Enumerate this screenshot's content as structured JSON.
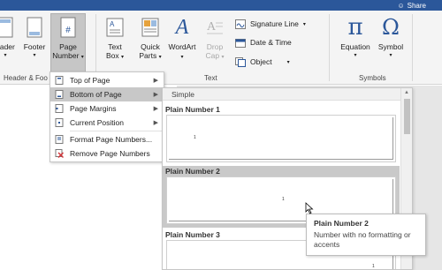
{
  "titlebar": {
    "share_label": "Share",
    "share_icon": "person-icon"
  },
  "ribbon": {
    "header_label": "eader",
    "footer_label": "Footer",
    "page_number_line1": "Page",
    "page_number_line2": "Number",
    "page_number_glyph": "#",
    "text_box_line1": "Text",
    "text_box_line2": "Box",
    "quick_parts_line1": "Quick",
    "quick_parts_line2": "Parts",
    "wordart_label": "WordArt",
    "wordart_glyph": "A",
    "drop_cap_line1": "Drop",
    "drop_cap_line2": "Cap",
    "drop_cap_glyph": "A",
    "signature_line_label": "Signature Line",
    "date_time_label": "Date & Time",
    "object_label": "Object",
    "equation_label": "Equation",
    "equation_glyph": "π",
    "symbol_label": "Symbol",
    "symbol_glyph": "Ω",
    "group_header_footer": "Header & Foo",
    "group_text": "Text",
    "group_symbols": "Symbols",
    "accent_color": "#2b579a",
    "active_bg": "#c6c6c6"
  },
  "menu": {
    "items": [
      {
        "label": "Top of Page",
        "has_submenu": true
      },
      {
        "label": "Bottom of Page",
        "has_submenu": true,
        "highlighted": true
      },
      {
        "label": "Page Margins",
        "has_submenu": true
      },
      {
        "label": "Current Position",
        "has_submenu": true
      },
      {
        "label": "Format Page Numbers...",
        "has_submenu": false
      },
      {
        "label": "Remove Page Numbers",
        "has_submenu": false
      }
    ]
  },
  "gallery": {
    "section_label": "Simple",
    "items": [
      {
        "title": "Plain Number 1",
        "number": "1"
      },
      {
        "title": "Plain Number 2",
        "number": "1",
        "selected": true
      },
      {
        "title": "Plain Number 3",
        "number": "1"
      }
    ]
  },
  "tooltip": {
    "title": "Plain Number 2",
    "description": "Number with no formatting or accents"
  }
}
